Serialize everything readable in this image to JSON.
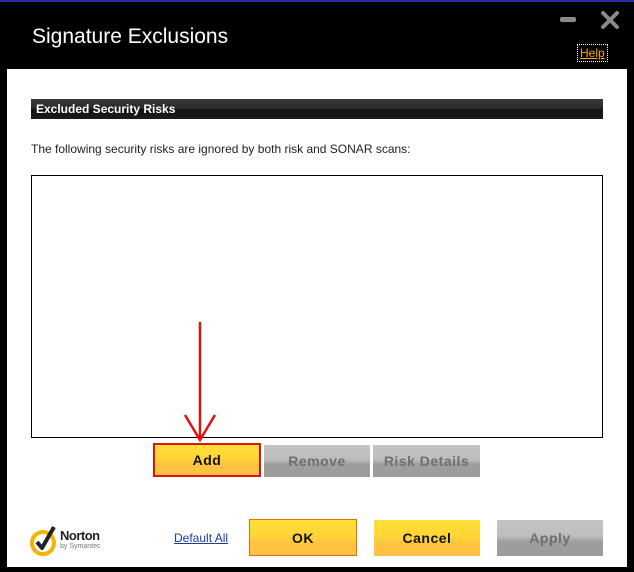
{
  "window": {
    "title": "Signature Exclusions",
    "help_label": "Help",
    "minimize_icon": "minimize-icon",
    "close_icon": "close-icon"
  },
  "section": {
    "header": "Excluded Security Risks",
    "description": "The following security risks are ignored by both risk and SONAR scans:",
    "list_items": []
  },
  "list_buttons": {
    "add": "Add",
    "remove": "Remove",
    "risk_details": "Risk Details"
  },
  "footer": {
    "logo_name": "Norton",
    "logo_sub": "by Symantec",
    "default_all": "Default All",
    "ok": "OK",
    "cancel": "Cancel",
    "apply": "Apply"
  },
  "annotation": {
    "arrow_color": "#e01010",
    "highlight": "Add"
  },
  "colors": {
    "accent_yellow": "#ffd535",
    "help_link": "#f5a800",
    "disabled_gray": "#bdbdbd"
  }
}
